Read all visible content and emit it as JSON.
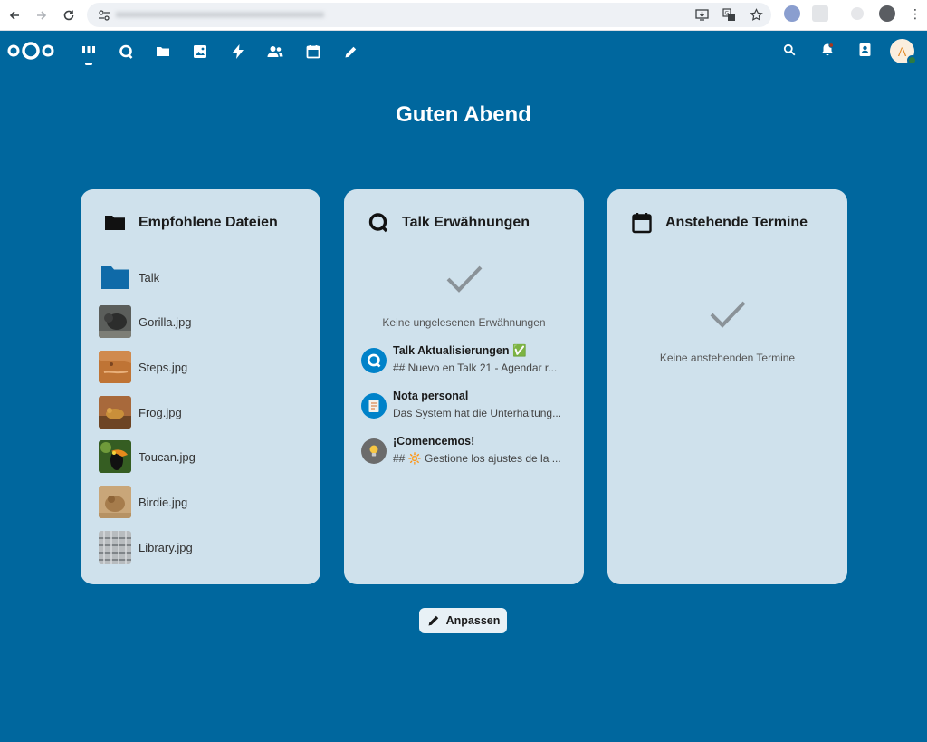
{
  "greeting": "Guten Abend",
  "widgets": {
    "files": {
      "title": "Empfohlene Dateien",
      "items": [
        {
          "name": "Talk"
        },
        {
          "name": "Gorilla.jpg"
        },
        {
          "name": "Steps.jpg"
        },
        {
          "name": "Frog.jpg"
        },
        {
          "name": "Toucan.jpg"
        },
        {
          "name": "Birdie.jpg"
        },
        {
          "name": "Library.jpg"
        }
      ]
    },
    "talk": {
      "title": "Talk Erwähnungen",
      "empty_text": "Keine ungelesenen Erwähnungen",
      "items": [
        {
          "title": "Talk Aktualisierungen ✅",
          "subtitle": "## Nuevo en Talk 21 - Agendar r..."
        },
        {
          "title": "Nota personal",
          "subtitle": "Das System hat die Unterhaltung..."
        },
        {
          "title": "¡Comencemos!",
          "subtitle": "## 🔆 Gestione los ajustes de la ..."
        }
      ]
    },
    "calendar": {
      "title": "Anstehende Termine",
      "empty_text": "Keine anstehenden Termine"
    }
  },
  "customize_button": "Anpassen",
  "avatar_initial": "A",
  "colors": {
    "background": "#00679e",
    "panel": "#cfe1ec",
    "folder": "#0f6aa8"
  }
}
